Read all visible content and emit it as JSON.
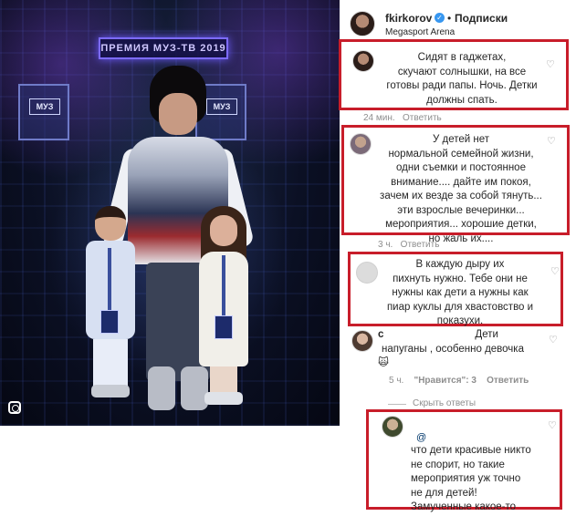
{
  "photo": {
    "banner_text": "ПРЕМИЯ МУЗ-ТВ 2019",
    "stage_logo_text": "МУЗ"
  },
  "post_header": {
    "username": "fkirkorov",
    "verified_mark": "✓",
    "separator": "•",
    "follow_label": "Подписки",
    "location": "Megasport Arena"
  },
  "comments": [
    {
      "text_lines": [
        "Сидят в гаджетах,",
        "скучают солнышки, на все",
        "готовы ради папы. Ночь. Детки",
        "должны спать."
      ],
      "time": "24 мин.",
      "reply_label": "Ответить",
      "highlighted": true
    },
    {
      "text_lines": [
        "У детей нет",
        "нормальной семейной жизни,",
        "одни съемки и постоянное",
        "внимание.... дайте им покоя,",
        "зачем их везде за собой тянуть...",
        "эти взрослые вечеринки...",
        "мероприятия... хорошие детки,",
        "но жаль их...."
      ],
      "time": "3 ч.",
      "reply_label": "Ответить",
      "highlighted": true
    },
    {
      "text_lines": [
        "В каждую дыру их",
        "пихнуть нужно. Тебе они не",
        "нужны как дети а нужны как",
        "пиар куклы для хвастовство и",
        "показухи."
      ],
      "highlighted": true
    },
    {
      "username": "с",
      "text_lines": [
        "Дети",
        "напуганы , особенно девочка"
      ],
      "emoji": "🙀",
      "time": "5 ч.",
      "likes_label": "\"Нравится\": 3",
      "reply_label": "Ответить",
      "highlighted": false
    }
  ],
  "hide_replies_label": "Скрыть ответы",
  "reply": {
    "mention": "@",
    "text_lines": [
      "что дети красивые никто",
      "не спорит, но такие",
      "мероприятия уж точно",
      "не для детей!",
      "Замученные какое-то"
    ]
  },
  "icons": {
    "heart": "♡"
  },
  "colors": {
    "highlight_border": "#c81d2a",
    "verified_badge": "#3897f0",
    "meta_text": "#8e8e8e"
  }
}
